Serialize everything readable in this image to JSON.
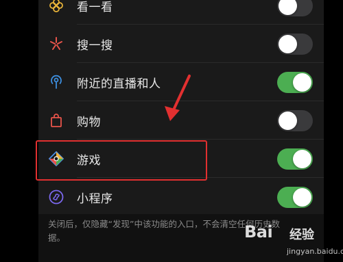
{
  "settings": {
    "items": [
      {
        "label": "看一看",
        "icon": "flower-icon",
        "enabled": false,
        "icon_color": "#e9b43a"
      },
      {
        "label": "搜一搜",
        "icon": "star-burst-icon",
        "enabled": false,
        "icon_color": "#e8544b"
      },
      {
        "label": "附近的直播和人",
        "icon": "live-location-icon",
        "enabled": true,
        "icon_color": "#3d8fe0"
      },
      {
        "label": "购物",
        "icon": "shopping-bag-icon",
        "enabled": false,
        "icon_color": "#e8544b"
      },
      {
        "label": "游戏",
        "icon": "game-diamond-icon",
        "enabled": true,
        "icon_color": "#4a8fe8"
      },
      {
        "label": "小程序",
        "icon": "mini-program-icon",
        "enabled": true,
        "icon_color": "#7b68ee"
      }
    ],
    "footer_note": "关闭后，仅隐藏“发现”中该功能的入口，不会清空任何历史数据。"
  },
  "watermark": {
    "main": "Bai",
    "sub": "经验",
    "url": "jingyan.baidu.com"
  },
  "colors": {
    "toggle_on": "#4cae52",
    "toggle_off": "#3a3a3c",
    "highlight": "#e23030",
    "background": "#1a1a1a"
  }
}
